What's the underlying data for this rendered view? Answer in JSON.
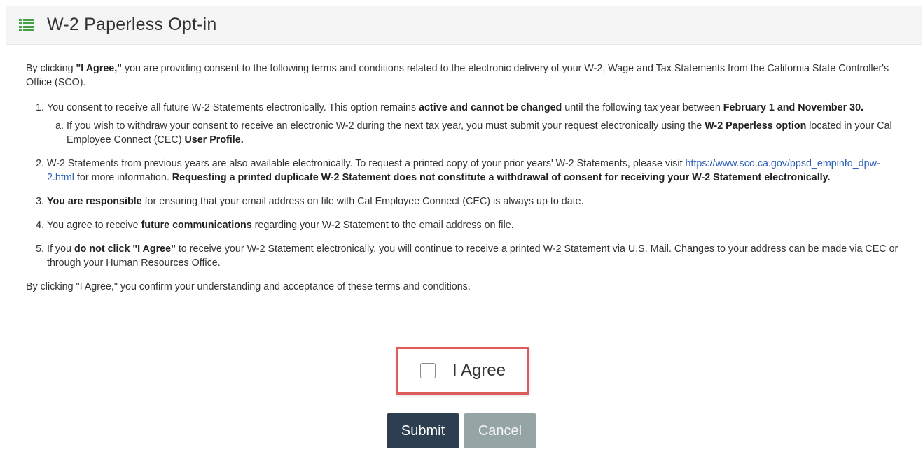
{
  "panel": {
    "title": "W-2 Paperless Opt-in",
    "icon": "list-icon",
    "accent_color": "#43a047"
  },
  "intro": {
    "prefix": "By clicking ",
    "bold": "\"I Agree,\"",
    "rest": " you are providing consent to the following terms and conditions related to the electronic delivery of your W-2, Wage and Tax Statements from the California State Controller's Office (SCO)."
  },
  "terms": {
    "item1": {
      "t1": "You consent to receive all future W-2 Statements electronically. This option remains ",
      "b1": "active and cannot be changed",
      "t2": " until the following tax year between ",
      "b2": "February 1 and November 30.",
      "sub_a": {
        "t1": "If you wish to withdraw your consent to receive an electronic W-2 during the next tax year, you must submit your request electronically using the ",
        "b1": "W-2 Paperless option",
        "t2": " located in your Cal Employee Connect (CEC) ",
        "b2": "User Profile."
      }
    },
    "item2": {
      "t1": "W-2 Statements from previous years are also available electronically. To request a printed copy of your prior years' W-2 Statements, please visit ",
      "link": "https://www.sco.ca.gov/ppsd_empinfo_dpw-2.html",
      "t2": " for more information. ",
      "b1": "Requesting a printed duplicate W-2 Statement does not constitute a withdrawal of consent for receiving your W-2 Statement electronically."
    },
    "item3": {
      "b1": "You are responsible",
      "t1": " for ensuring that your email address on file with Cal Employee Connect (CEC) is always up to date."
    },
    "item4": {
      "t1": "You agree to receive ",
      "b1": "future communications",
      "t2": " regarding your W-2 Statement to the email address on file."
    },
    "item5": {
      "t1": "If you ",
      "b1": "do not click \"I Agree\"",
      "t2": " to receive your W-2 Statement electronically, you will continue to receive a printed W-2 Statement via U.S. Mail. Changes to your address can be made via CEC or through your Human Resources Office."
    }
  },
  "closing": "By clicking \"I Agree,\" you confirm your understanding and acceptance of these terms and conditions.",
  "agree": {
    "label": "I Agree",
    "checked": false,
    "highlight_color": "#e05b5b"
  },
  "buttons": {
    "submit": "Submit",
    "cancel": "Cancel",
    "submit_color": "#2c3e50",
    "cancel_color": "#95a5a6"
  }
}
